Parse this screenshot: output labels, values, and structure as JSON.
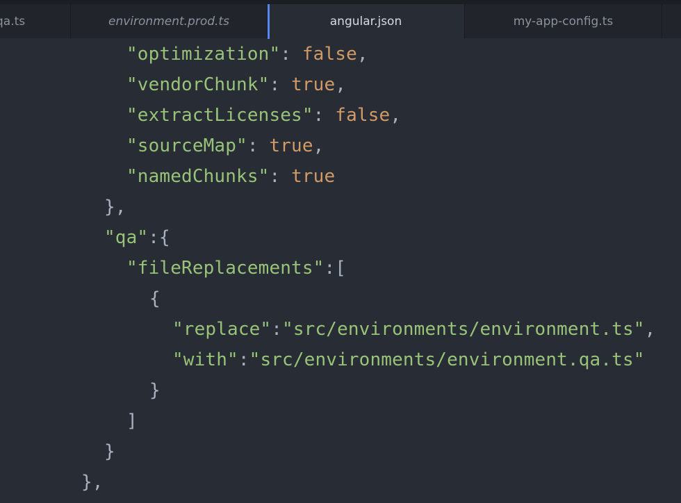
{
  "tabs": [
    {
      "label": "qa.ts",
      "active": false,
      "italic": false
    },
    {
      "label": "environment.prod.ts",
      "active": false,
      "italic": true
    },
    {
      "label": "angular.json",
      "active": true,
      "italic": false
    },
    {
      "label": "my-app-config.ts",
      "active": false,
      "italic": false
    },
    {
      "label": "",
      "active": false,
      "italic": false
    }
  ],
  "code": {
    "lines": [
      {
        "key": "\"optimization\"",
        "sep": ": ",
        "value": "false",
        "tail": ","
      },
      {
        "key": "\"vendorChunk\"",
        "sep": ": ",
        "value": "true",
        "tail": ","
      },
      {
        "key": "\"extractLicenses\"",
        "sep": ": ",
        "value": "false",
        "tail": ","
      },
      {
        "key": "\"sourceMap\"",
        "sep": ": ",
        "value": "true",
        "tail": ","
      },
      {
        "key": "\"namedChunks\"",
        "sep": ": ",
        "value": "true",
        "tail": ""
      },
      {
        "punct": "},"
      },
      {
        "key": "\"qa\"",
        "sep": ":",
        "punct2": "{"
      },
      {
        "key": "\"fileReplacements\"",
        "sep": ":",
        "punct2": "["
      },
      {
        "punct": "{"
      },
      {
        "key": "\"replace\"",
        "sep": ":",
        "str": "\"src/environments/environment.ts\"",
        "tail": ","
      },
      {
        "key": "\"with\"",
        "sep": ":",
        "str": "\"src/environments/environment.qa.ts\"",
        "tail": ""
      },
      {
        "punct": "}"
      },
      {
        "punct": "]"
      },
      {
        "punct": "}"
      },
      {
        "punct": "},"
      }
    ]
  },
  "colors": {
    "background": "#282c34",
    "tabbar": "#21252b",
    "string": "#98c379",
    "boolean": "#d19a66",
    "punctuation": "#abb2bf",
    "active_tab_indicator": "#568af2"
  }
}
